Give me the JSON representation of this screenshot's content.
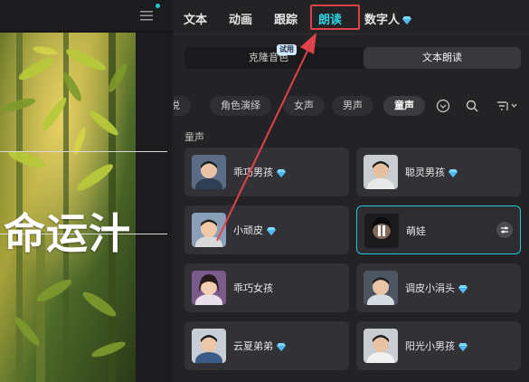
{
  "preview": {
    "caption": "命运汁",
    "menu_icon": "hamburger-menu-icon"
  },
  "tabs": [
    {
      "label": "文本"
    },
    {
      "label": "动画"
    },
    {
      "label": "跟踪"
    },
    {
      "label": "朗读",
      "active": true
    },
    {
      "label": "数字人",
      "icon": "diamond-icon"
    }
  ],
  "mode_toggle": {
    "clone_label": "克隆音色",
    "tts_label": "文本朗读",
    "selected": "文本朗读",
    "trial_badge": "试用"
  },
  "filters": {
    "chips": [
      "说",
      "角色演绎",
      "女声",
      "男声",
      "童声"
    ],
    "active": "童声",
    "icons": [
      "chevron-down-circle-icon",
      "search-icon",
      "sort-filter-icon"
    ]
  },
  "section": {
    "label": "童声"
  },
  "voices": [
    {
      "name": "乖巧男孩",
      "premium": true
    },
    {
      "name": "聪灵男孩",
      "premium": true
    },
    {
      "name": "小顽皮",
      "premium": true
    },
    {
      "name": "萌娃",
      "premium": false,
      "selected": true,
      "playing": true
    },
    {
      "name": "乖巧女孩",
      "premium": false
    },
    {
      "name": "调皮小涓头",
      "premium": true
    },
    {
      "name": "云夏弟弟",
      "premium": true
    },
    {
      "name": "阳光小男孩",
      "premium": true
    }
  ],
  "colors": {
    "accent": "#2bd3e3",
    "highlight_box": "#e0424a",
    "panel_bg": "#232326",
    "card_bg": "#323236",
    "premium_gem": "#7fd8ff"
  }
}
